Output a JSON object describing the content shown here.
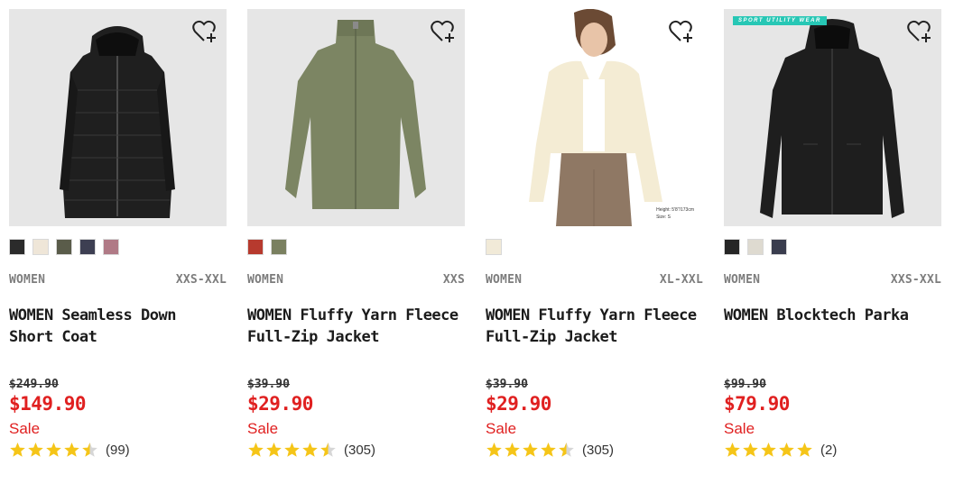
{
  "products": [
    {
      "image": "black-down-coat",
      "badge": "",
      "model_note": [],
      "swatches": [
        "#2b2b2b",
        "#efe6d8",
        "#5a5c4a",
        "#3d3f52",
        "#b07a86"
      ],
      "gender": "WOMEN",
      "sizes": "XXS-XXL",
      "name_line1": "WOMEN Seamless Down",
      "name_line2": "Short Coat",
      "original_price": "$249.90",
      "price": "$149.90",
      "sale_label": "Sale",
      "rating": 4.5,
      "review_count": "(99)"
    },
    {
      "image": "olive-fleece-jacket",
      "badge": "",
      "model_note": [],
      "swatches": [
        "#b73a2e",
        "#7a8060"
      ],
      "gender": "WOMEN",
      "sizes": "XXS",
      "name_line1": "WOMEN Fluffy Yarn Fleece",
      "name_line2": "Full-Zip Jacket",
      "original_price": "$39.90",
      "price": "$29.90",
      "sale_label": "Sale",
      "rating": 4.5,
      "review_count": "(305)"
    },
    {
      "image": "cream-fleece-model",
      "badge": "",
      "model_note": [
        "Height: 5'8\"/173cm",
        "Size: S"
      ],
      "swatches": [
        "#f1ead8"
      ],
      "gender": "WOMEN",
      "sizes": "XL-XXL",
      "name_line1": "WOMEN Fluffy Yarn Fleece",
      "name_line2": "Full-Zip Jacket",
      "original_price": "$39.90",
      "price": "$29.90",
      "sale_label": "Sale",
      "rating": 4.5,
      "review_count": "(305)"
    },
    {
      "image": "black-parka",
      "badge": "SPORT UTILITY WEAR",
      "model_note": [],
      "swatches": [
        "#262626",
        "#dedad0",
        "#3a3d4e"
      ],
      "gender": "WOMEN",
      "sizes": "XXS-XXL",
      "name_line1": "WOMEN Blocktech Parka",
      "name_line2": "",
      "original_price": "$99.90",
      "price": "$79.90",
      "sale_label": "Sale",
      "rating": 5,
      "review_count": "(2)"
    }
  ],
  "colors": {
    "sale": "#e02020",
    "star": "#f5c518",
    "star_empty": "#d6d6d6"
  },
  "icons": {
    "favorite": "heart-plus-icon",
    "rating": "star-icon"
  }
}
